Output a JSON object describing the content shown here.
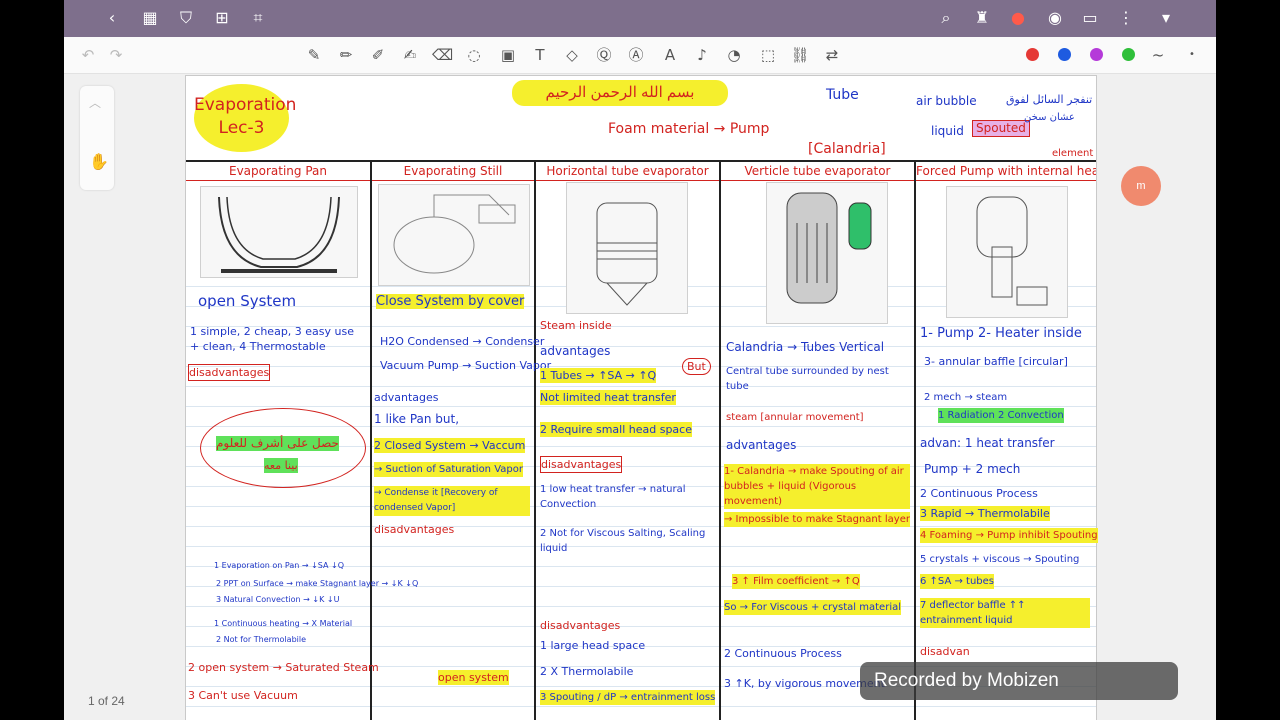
{
  "app": {
    "topbar_icons": [
      "back-icon",
      "grid-icon",
      "bookmark-icon",
      "add-page-icon",
      "crop-icon",
      "search-icon",
      "shirt-icon",
      "record-icon",
      "eye-icon",
      "pages-icon",
      "more-icon",
      "dropdown-icon"
    ],
    "toolbar_tools": [
      "undo-icon",
      "redo-icon",
      "pen-icon",
      "pencil-icon",
      "marker-icon",
      "highlighter-icon",
      "eraser-icon",
      "lasso-icon",
      "image-icon",
      "text-box-icon",
      "shape-icon",
      "ocr-icon",
      "text-recognition-icon",
      "ai-icon",
      "mic-icon",
      "sticker-icon",
      "screenshot-icon",
      "link-icon",
      "translate-icon"
    ],
    "pen_colors": [
      "#e53935",
      "#1e5be0",
      "#b53ad9",
      "#2fbf3a",
      "#555555"
    ],
    "page_indicator": "1 of 24",
    "watermark": "Recorded by Mobizen"
  },
  "note": {
    "title_line1": "Evaporation",
    "title_line2": "Lec-3",
    "bismillah": "بسم الله الرحمن الرحيم",
    "foam_note": "Foam material → Pump",
    "tube_note": "Tube",
    "air_bubble": "air bubble",
    "liquid": "liquid",
    "spouted": "Spouted",
    "calandria": "[Calandria]",
    "element": "element",
    "arabic_top": "تنفجر السائل لفوق",
    "arabic_top2": "عشان سخن",
    "columns": [
      {
        "header": "Evaporating Pan",
        "items": [
          "open System",
          "1 simple, 2 cheap, 3 easy use + clean, 4 Thermostable",
          "disadvantages",
          "1 Evaporation on Pan → ↓SA ↓Q",
          "2 PPT on Surface → make Stagnant layer → ↓K ↓Q",
          "3 Natural Convection → ↓K ↓U",
          "1 Continuous heating → X Material",
          "2 Not for Thermolabile",
          "2 open system → Saturated Steam",
          "3 Can't use Vacuum"
        ]
      },
      {
        "header": "Evaporating Still",
        "items": [
          "Close System by cover",
          "H2O Condensed → Condenser",
          "Vacuum Pump → Suction Vapor",
          "advantages",
          "1 like Pan but,",
          "2 Closed System → Vaccum",
          "→ Suction of Saturation Vapor",
          "→ Condense it [Recovery of condensed Vapor]",
          "disadvantages",
          "open system"
        ]
      },
      {
        "header": "Horizontal tube evaporator",
        "items": [
          "Steam inside",
          "advantages",
          "1 Tubes → ↑SA → ↑Q",
          "Not limited heat transfer",
          "2 Require small head space",
          "disadvantages",
          "1 low heat transfer → natural Convection",
          "2 Not for Viscous Salting, Scaling liquid",
          "disadvantages",
          "1 large head space",
          "2 X Thermolabile",
          "3 Spouting / dP → entrainment loss"
        ]
      },
      {
        "header": "Verticle tube evaporator",
        "items": [
          "Calandria → Tubes Vertical",
          "Central tube surrounded by nest tube",
          "steam [annular movement]",
          "advantages",
          "1- Calandria → make Spouting of air bubbles + liquid (Vigorous movement)",
          "→ Impossible to make Stagnant layer",
          "3 ↑ Film coefficient → ↑Q",
          "So → For Viscous + crystal material",
          "2 Continuous Process",
          "3 ↑K, by vigorous movement"
        ]
      },
      {
        "header": "Forced Pump with internal heater",
        "items": [
          "1- Pump  2- Heater inside",
          "3- annular baffle [circular]",
          "2 mech → steam",
          "1 Radiation  2 Convection",
          "advan: 1 heat transfer",
          "Pump + 2 mech",
          "2 Continuous Process",
          "3 Rapid → Thermolabile",
          "4 Foaming → Pump inhibit Spouting",
          "5 crystals + viscous → Spouting",
          "6 ↑SA → tubes",
          "7 deflector baffle ↑↑ entrainment liquid",
          "disadvan"
        ]
      }
    ],
    "cloud_text_ar": "حصل على أشرف للعلوم",
    "cloud_text_ar2": "بينا معه",
    "but_note": "But",
    "caption_tubes": "(Tubes)"
  }
}
